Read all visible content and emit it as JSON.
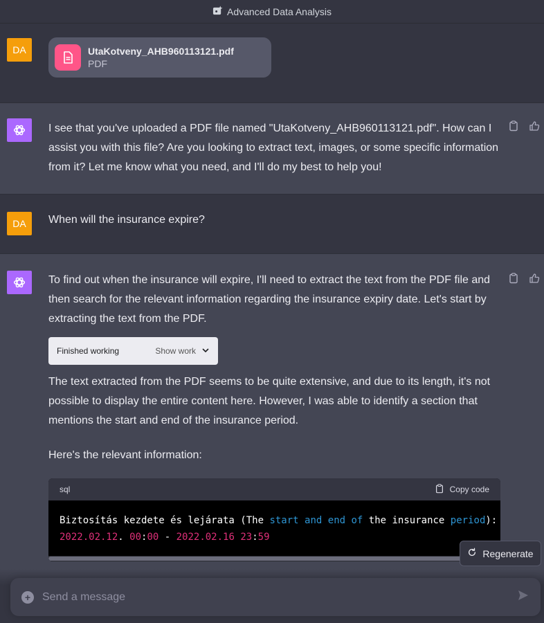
{
  "header": {
    "title": "Advanced Data Analysis"
  },
  "user": {
    "initials": "DA"
  },
  "messages": {
    "m1": {
      "file_name": "UtaKotveny_AHB960113121.pdf",
      "file_type": "PDF"
    },
    "m2": {
      "lines": [
        "I see that you've uploaded a PDF file named \"UtaKotveny_AHB960113121.pdf\". How can I",
        "assist you with this file? Are you looking to extract text, images, or some specific information",
        "from it? Let me know what you need, and I'll do my best to help you!"
      ]
    },
    "m3": {
      "text": "When will the insurance expire?"
    },
    "m4": {
      "intro": [
        "To find out when the insurance will expire, I'll need to extract the text from the PDF file and",
        "then search for the relevant information regarding the insurance expiry date. Let's start by",
        "extracting the text from the PDF."
      ],
      "tool_status": "Finished working",
      "tool_toggle": "Show work",
      "para2": [
        "The text extracted from the PDF seems to be quite extensive, and due to its length, it's not",
        "possible to display the entire content here. However, I was able to identify a section that",
        "mentions the start and end of the insurance period."
      ],
      "para3": "Here's the relevant information:",
      "code": {
        "language": "sql",
        "copy_label": "Copy code",
        "line1": {
          "a": "Biztosítás kezdete és lejárata (The ",
          "kw1": "start",
          "b": " ",
          "kw2": "and",
          "c": " ",
          "kw3": "end",
          "d": " ",
          "kw4": "of",
          "e": " the insurance ",
          "kw5": "period",
          "f": "):"
        },
        "line2": {
          "n1": "2022.02.12",
          "a": ". ",
          "n2": "00",
          "b": ":",
          "n3": "00",
          "c": " - ",
          "n4": "2022.02.16",
          "d": " ",
          "n5": "23",
          "e": ":",
          "n6": "59"
        }
      }
    }
  },
  "regenerate_label": "Regenerate",
  "composer": {
    "placeholder": "Send a message"
  }
}
